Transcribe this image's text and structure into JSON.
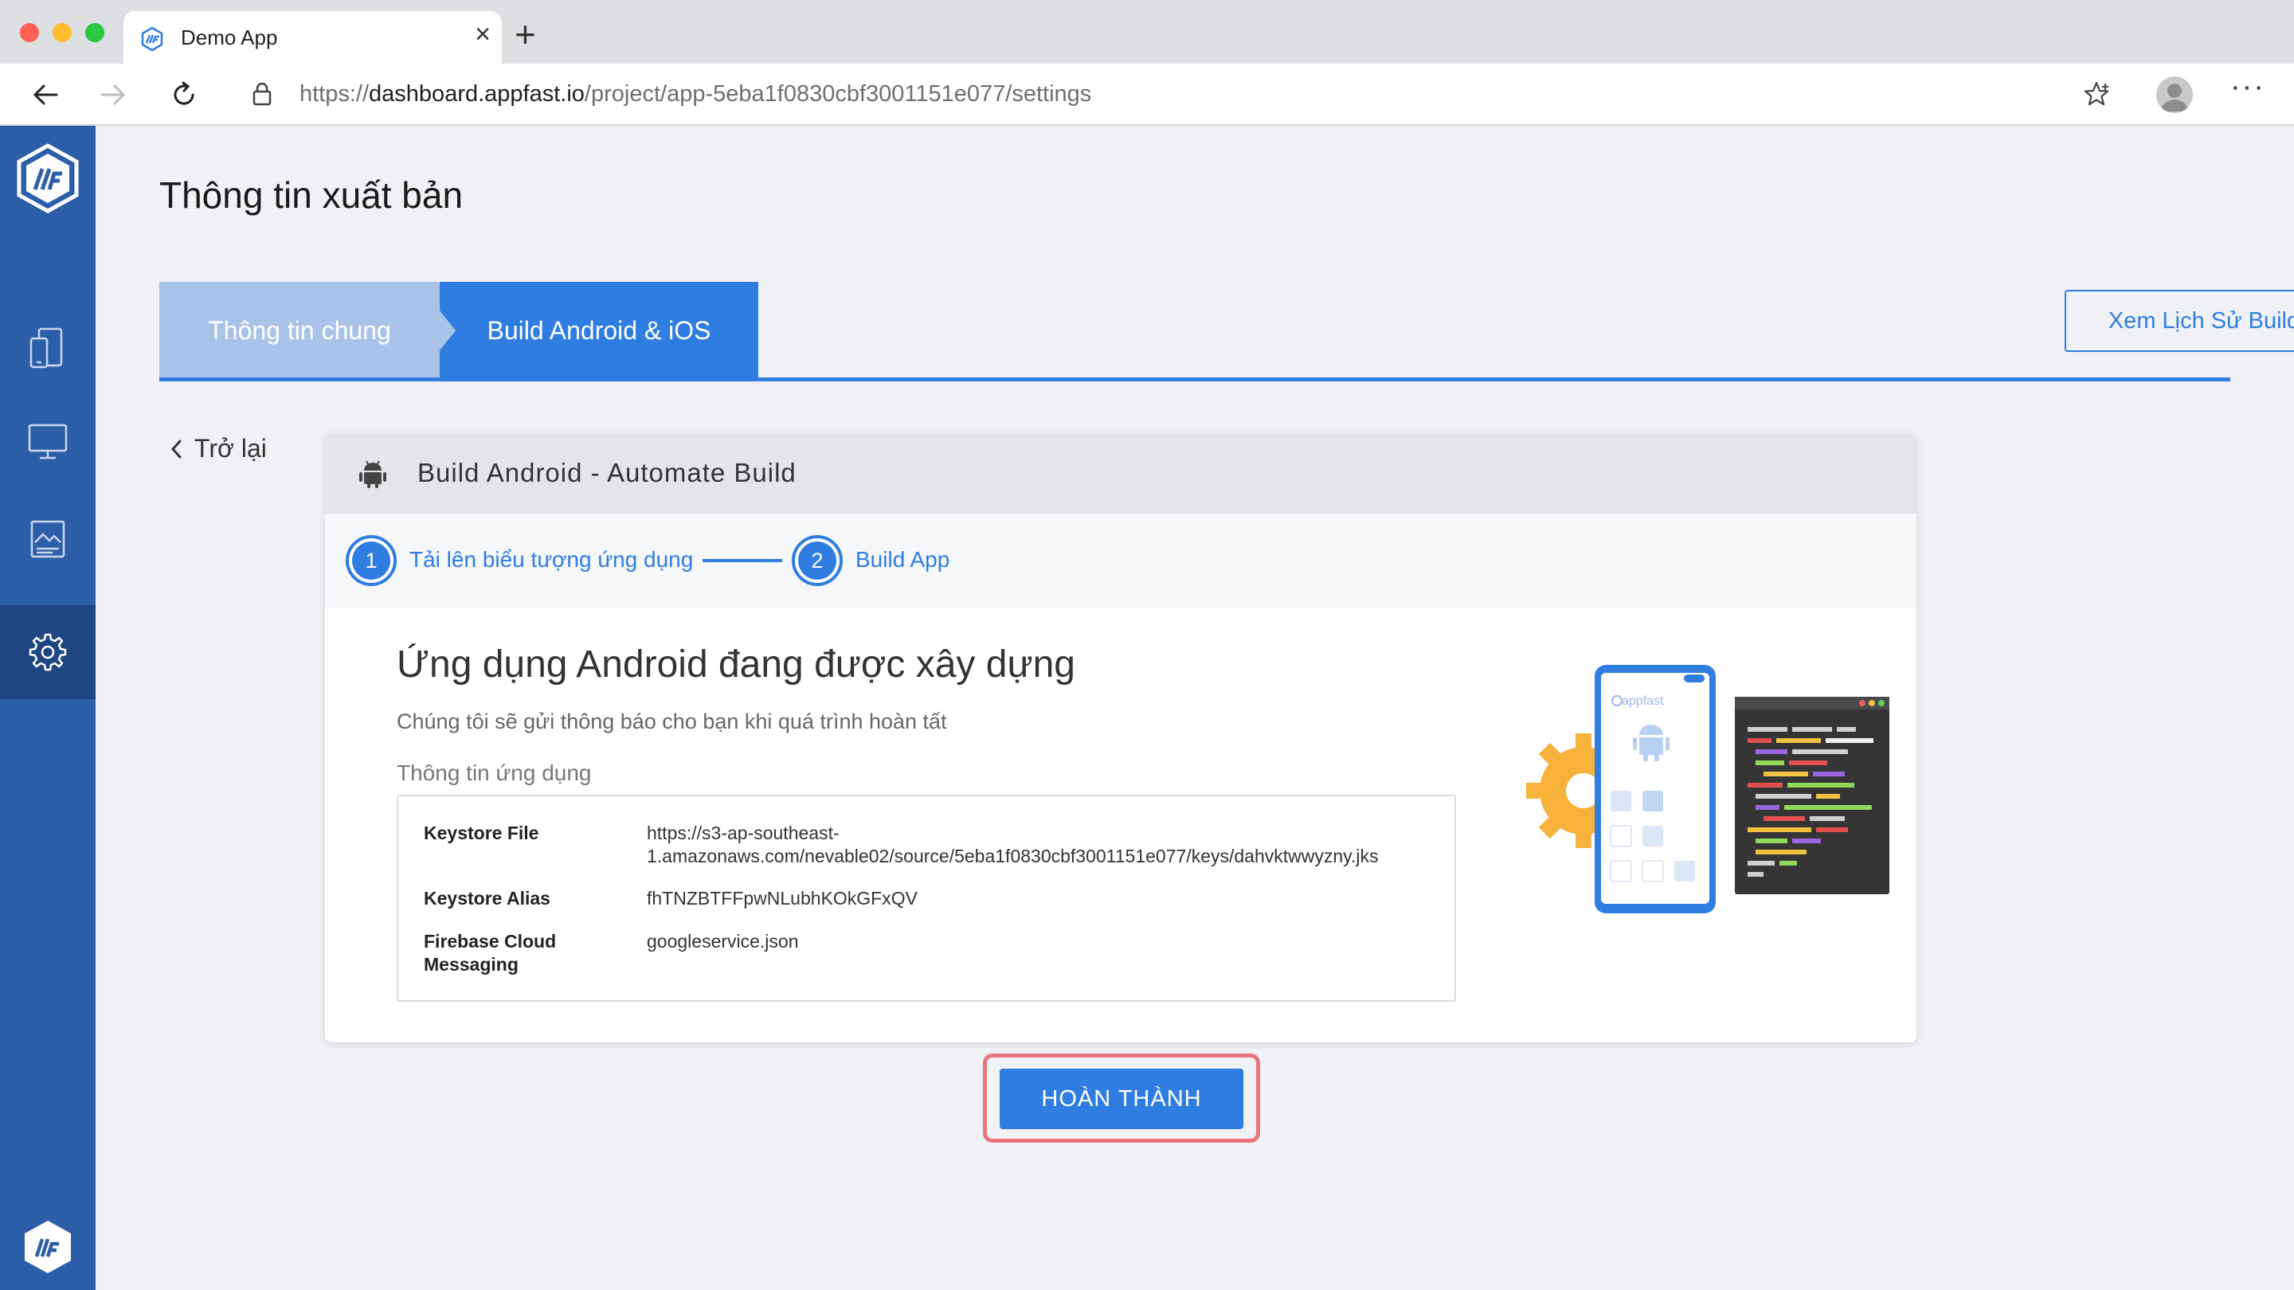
{
  "browser": {
    "tab_title": "Demo App",
    "url_prefix": "https://",
    "url_domain": "dashboard.appfast.io",
    "url_path": "/project/app-5eba1f0830cbf3001151e077/settings"
  },
  "sidebar": {
    "items": [
      {
        "icon": "devices-icon",
        "active": false
      },
      {
        "icon": "monitor-icon",
        "active": false
      },
      {
        "icon": "image-icon",
        "active": false
      },
      {
        "icon": "bell-icon",
        "active": false
      },
      {
        "icon": "gear-icon",
        "active": true
      }
    ],
    "color": "#2d5fa8",
    "active_color": "#1e4683"
  },
  "page": {
    "title": "Thông tin xuất bản",
    "tabs": [
      {
        "label": "Thông tin chung",
        "active": false
      },
      {
        "label": "Build Android & iOS",
        "active": true
      }
    ],
    "history_button": "Xem Lịch Sử Build App",
    "back_label": "Trở lại"
  },
  "card": {
    "header_title": "Build Android - Automate Build",
    "steps": [
      {
        "number": "1",
        "label": "Tải lên biểu tượng ứng dụng"
      },
      {
        "number": "2",
        "label": "Build App"
      }
    ],
    "main_title": "Ứng dụng Android đang được xây dựng",
    "subtitle": "Chúng tôi sẽ gửi thông báo cho bạn khi quá trình hoàn tất",
    "section_label": "Thông tin ứng dụng",
    "info": {
      "keystore_file_label": "Keystore File",
      "keystore_file_value_line1": "https://s3-ap-southeast-",
      "keystore_file_value_line2": "1.amazonaws.com/nevable02/source/5eba1f0830cbf3001151e077/keys/dahvktwwyzny.jks",
      "keystore_alias_label": "Keystore Alias",
      "keystore_alias_value": "fhTNZBTFFpwNLubhKOkGFxQV",
      "firebase_label_line1": "Firebase Cloud",
      "firebase_label_line2": "Messaging",
      "firebase_value": "googleservice.json"
    },
    "illustration_brand": "appfast"
  },
  "done_button": "HOÀN THÀNH",
  "colors": {
    "accent": "#2f7de1",
    "tab_inactive": "#a9c3e8",
    "highlight_border": "#e8757d"
  }
}
